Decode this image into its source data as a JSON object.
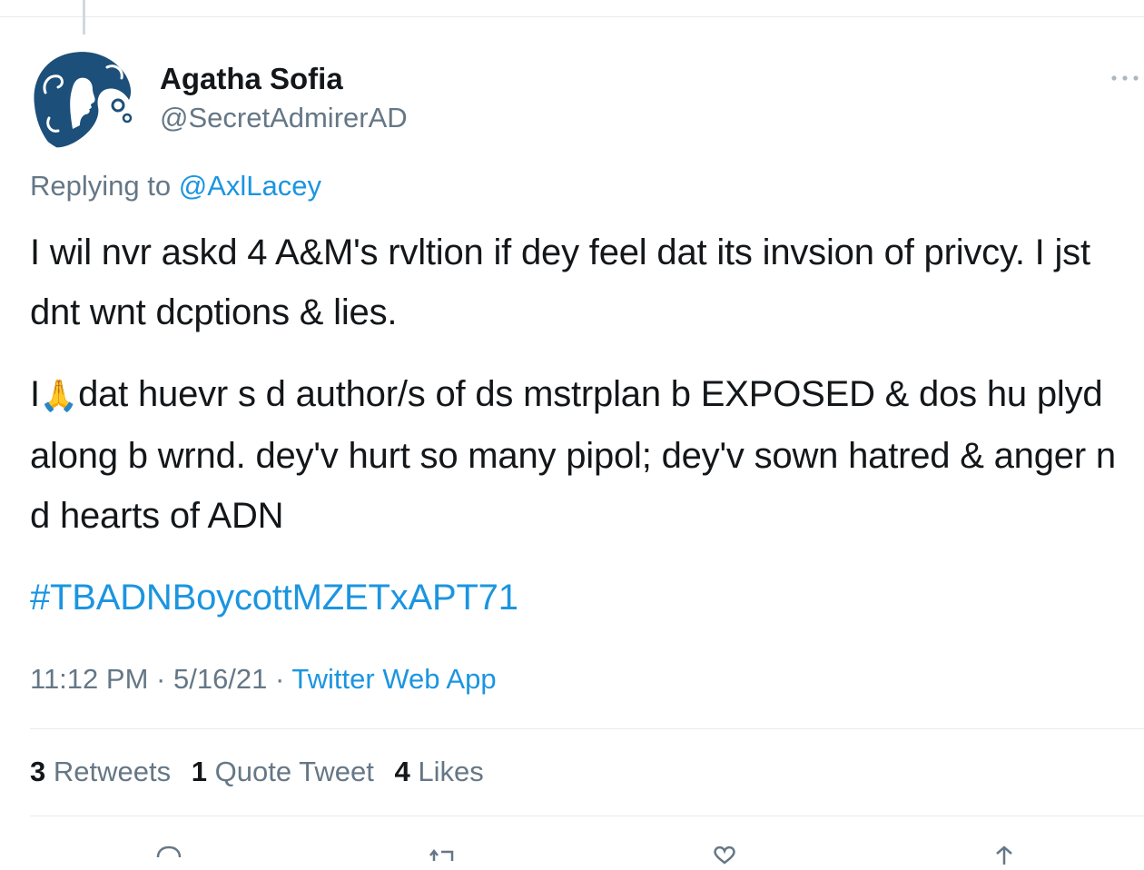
{
  "author": {
    "display_name": "Agatha Sofia",
    "handle": "@SecretAdmirerAD",
    "avatar_icon": "woman-silhouette-avatar-icon"
  },
  "reply": {
    "prefix": "Replying to",
    "to": "@AxlLacey"
  },
  "tweet": {
    "paragraph1": "I wil nvr askd 4 A&M's rvltion if dey feel dat its invsion of privcy. I jst dnt wnt dcptions & lies.",
    "paragraph2_start": "I",
    "paragraph2_emoji": "🙏",
    "paragraph2_rest": "dat huevr s d author/s of ds mstrplan b EXPOSED & dos hu plyd along b wrnd. dey'v hurt so many pipol; dey'v sown hatred & anger n d hearts of ADN",
    "hashtag": "#TBADNBoycottMZETxAPT71"
  },
  "meta": {
    "time": "11:12 PM",
    "separator": "·",
    "date": "5/16/21",
    "source": "Twitter Web App"
  },
  "stats": {
    "retweets_count": "3",
    "retweets_label": "Retweets",
    "quotes_count": "1",
    "quotes_label": "Quote Tweet",
    "likes_count": "4",
    "likes_label": "Likes"
  },
  "colors": {
    "link": "#1b95e0",
    "secondary_text": "#657786",
    "primary_text": "#14171a",
    "divider": "#e6ecf0",
    "avatar_blue": "#1c4f7a"
  }
}
